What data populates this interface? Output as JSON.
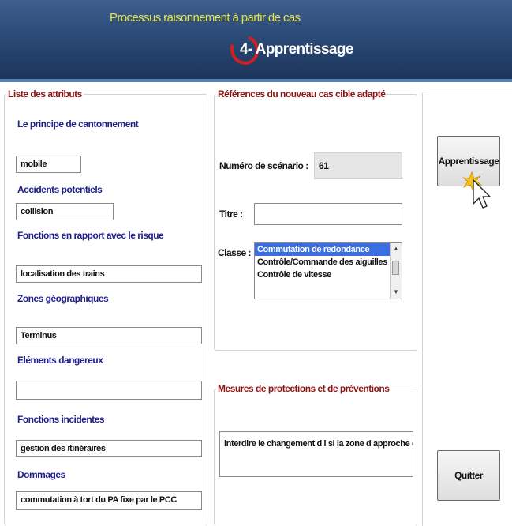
{
  "header": {
    "breadcrumb": "Processus raisonnement à partir de cas",
    "step_title": "4- Apprentissage"
  },
  "attributes_panel": {
    "legend": "Liste des attributs",
    "fields": [
      {
        "label": "Le principe de cantonnement",
        "value": "mobile"
      },
      {
        "label": "Accidents potentiels",
        "value": "collision"
      },
      {
        "label": "Fonctions en rapport avec le risque",
        "value": "localisation des trains"
      },
      {
        "label": "Zones géographiques",
        "value": "Terminus"
      },
      {
        "label": "Eléments dangereux",
        "value": ""
      },
      {
        "label": "Fonctions incidentes",
        "value": "gestion des itinéraires"
      },
      {
        "label": "Dommages",
        "value": "commutation à tort du PA fixe par le PCC"
      }
    ]
  },
  "references_panel": {
    "legend": "Références du nouveau cas cible adapté",
    "scenario_label": "Numéro de scénario :",
    "scenario_value": "61",
    "title_label": "Titre :",
    "title_value": "",
    "class_label": "Classe :",
    "class_options": [
      "Commutation de redondance",
      "Contrôle/Commande des aiguilles",
      "Contrôle de vitesse"
    ],
    "class_selected": "Commutation de redondance"
  },
  "measures_panel": {
    "legend": "Mesures de protections et de préventions",
    "value": "interdire le changement d l si la zone d approche d AG est occ"
  },
  "buttons": {
    "learn": "Apprentissage",
    "quit": "Quitter"
  }
}
